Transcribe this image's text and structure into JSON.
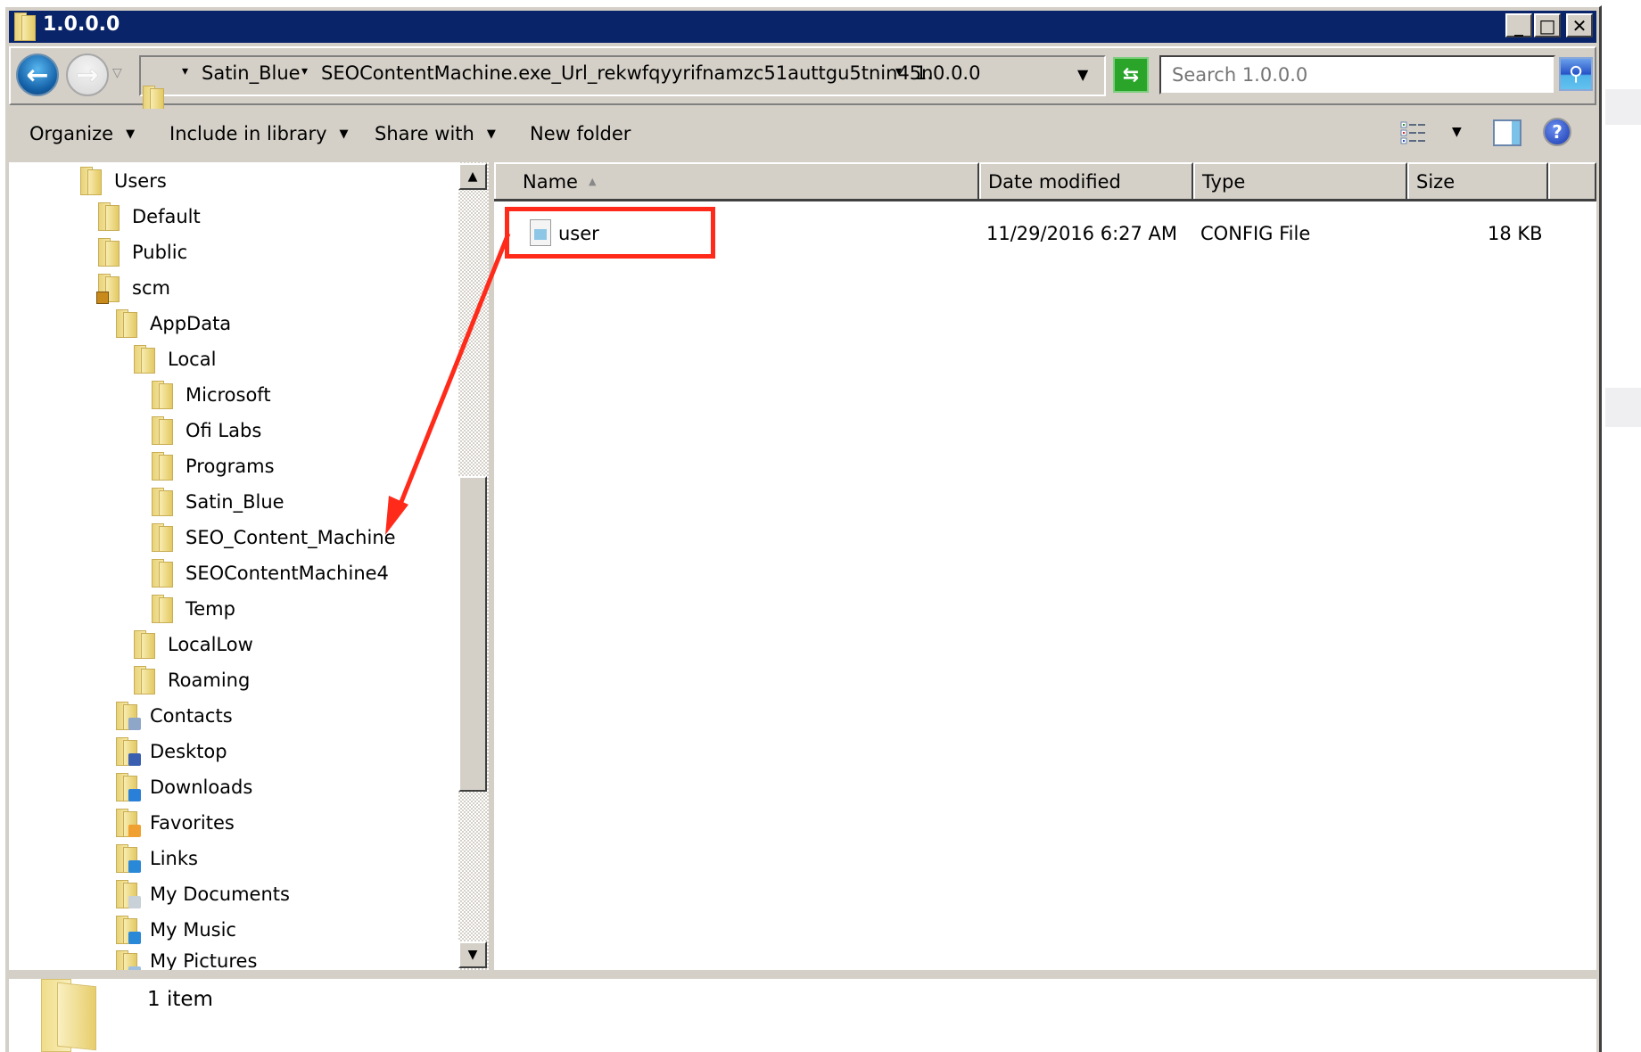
{
  "window": {
    "title": "1.0.0.0",
    "controls": {
      "minimize": "_",
      "maximize": "□",
      "close": "✕"
    }
  },
  "navigation": {
    "back_icon": "←",
    "forward_icon": "→",
    "recent_icon": "▽",
    "breadcrumbs": [
      "Satin_Blue",
      "SEOContentMachine.exe_Url_rekwfqyyrifnamzc51auttgu5tnin45n",
      "1.0.0.0"
    ],
    "breadcrumb_sep": "▾",
    "address_dropdown": "▼",
    "refresh_icon": "⇆",
    "search_placeholder": "Search 1.0.0.0",
    "search_icon": "⚲"
  },
  "toolbar": {
    "items": [
      {
        "label": "Organize",
        "has_dropdown": true
      },
      {
        "label": "Include in library",
        "has_dropdown": true
      },
      {
        "label": "Share with",
        "has_dropdown": true
      },
      {
        "label": "New folder",
        "has_dropdown": false
      }
    ],
    "caret": "▼",
    "view_dropdown": "▼",
    "help_icon": "?"
  },
  "tree": {
    "items": [
      {
        "label": "Users",
        "level": 0,
        "icon": "folder"
      },
      {
        "label": "Default",
        "level": 1,
        "icon": "folder"
      },
      {
        "label": "Public",
        "level": 1,
        "icon": "folder"
      },
      {
        "label": "scm",
        "level": 1,
        "icon": "folder-locked"
      },
      {
        "label": "AppData",
        "level": 2,
        "icon": "folder"
      },
      {
        "label": "Local",
        "level": 3,
        "icon": "folder"
      },
      {
        "label": "Microsoft",
        "level": 4,
        "icon": "folder"
      },
      {
        "label": "Ofi Labs",
        "level": 4,
        "icon": "folder"
      },
      {
        "label": "Programs",
        "level": 4,
        "icon": "folder"
      },
      {
        "label": "Satin_Blue",
        "level": 4,
        "icon": "folder"
      },
      {
        "label": "SEO_Content_Machine",
        "level": 4,
        "icon": "folder"
      },
      {
        "label": "SEOContentMachine4",
        "level": 4,
        "icon": "folder"
      },
      {
        "label": "Temp",
        "level": 4,
        "icon": "folder"
      },
      {
        "label": "LocalLow",
        "level": 3,
        "icon": "folder"
      },
      {
        "label": "Roaming",
        "level": 3,
        "icon": "folder"
      },
      {
        "label": "Contacts",
        "level": 2,
        "icon": "folder-contacts"
      },
      {
        "label": "Desktop",
        "level": 2,
        "icon": "folder-desktop"
      },
      {
        "label": "Downloads",
        "level": 2,
        "icon": "folder-downloads"
      },
      {
        "label": "Favorites",
        "level": 2,
        "icon": "folder-favorites"
      },
      {
        "label": "Links",
        "level": 2,
        "icon": "folder-links"
      },
      {
        "label": "My Documents",
        "level": 2,
        "icon": "folder-documents"
      },
      {
        "label": "My Music",
        "level": 2,
        "icon": "folder-music"
      },
      {
        "label": "My Pictures",
        "level": 2,
        "icon": "folder-pictures"
      }
    ],
    "scroll_up": "▲",
    "scroll_down": "▼"
  },
  "file_list": {
    "columns": {
      "name": "Name",
      "date": "Date modified",
      "type": "Type",
      "size": "Size"
    },
    "sort_indicator": "▲",
    "rows": [
      {
        "name": "user",
        "date": "11/29/2016 6:27 AM",
        "type": "CONFIG File",
        "size": "18 KB"
      }
    ]
  },
  "annotation": {
    "color": "#ff2a1a",
    "description": "Red box around file 'user' with arrow pointing to tree item SEO_Content_Machine"
  },
  "status": {
    "item_count": "1 item"
  }
}
